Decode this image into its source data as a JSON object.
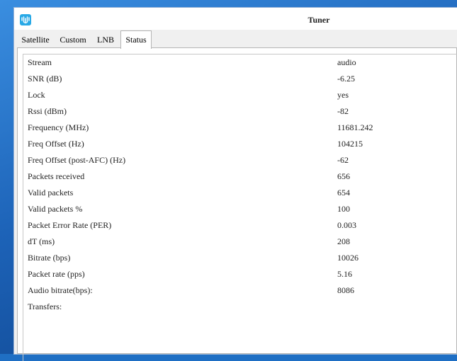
{
  "window": {
    "title": "Tuner"
  },
  "tabs": [
    {
      "label": "Satellite"
    },
    {
      "label": "Custom"
    },
    {
      "label": "LNB"
    },
    {
      "label": "Status",
      "active": true
    }
  ],
  "status": {
    "rows": [
      {
        "key": "Stream",
        "value": "audio"
      },
      {
        "key": "SNR (dB)",
        "value": "-6.25"
      },
      {
        "key": "Lock",
        "value": "yes"
      },
      {
        "key": "Rssi (dBm)",
        "value": "-82"
      },
      {
        "key": "Frequency (MHz)",
        "value": "11681.242"
      },
      {
        "key": "Freq Offset (Hz)",
        "value": "104215"
      },
      {
        "key": "Freq Offset (post-AFC) (Hz)",
        "value": "-62"
      },
      {
        "key": "Packets received",
        "value": "656"
      },
      {
        "key": "Valid packets",
        "value": "654"
      },
      {
        "key": "Valid packets %",
        "value": "100"
      },
      {
        "key": "Packet Error Rate (PER)",
        "value": "0.003"
      },
      {
        "key": "dT (ms)",
        "value": "208"
      },
      {
        "key": "Bitrate (bps)",
        "value": "10026"
      },
      {
        "key": "Packet rate (pps)",
        "value": "5.16"
      },
      {
        "key": "Audio bitrate(bps):",
        "value": "8086"
      },
      {
        "key": "Transfers:",
        "value": ""
      }
    ]
  },
  "icons": {
    "app": "waveform-app-icon"
  },
  "colors": {
    "app_icon": "#29a9e6",
    "window_bg": "#f0f0f0",
    "panel_bg": "#ffffff"
  }
}
